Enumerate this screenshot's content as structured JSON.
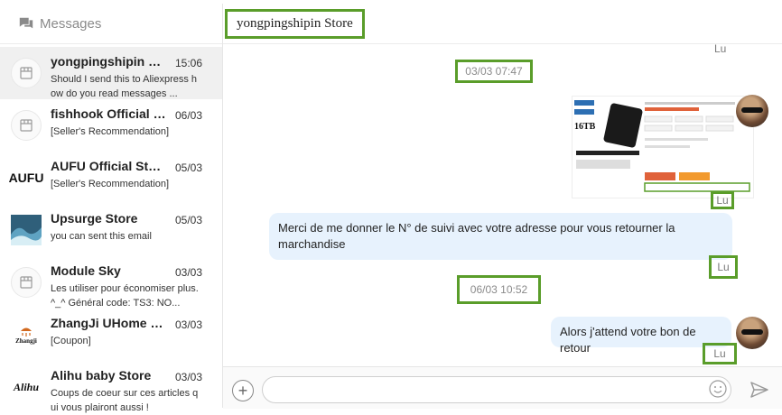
{
  "sidebar": {
    "title": "Messages",
    "conversations": [
      {
        "name": "yongpingshipin Store",
        "date": "15:06",
        "preview": "Should I send this to Aliexpress how do you read messages ...",
        "avatar": "store-icon",
        "active": true
      },
      {
        "name": "fishhook Official Store",
        "date": "06/03",
        "preview": "[Seller's Recommendation]",
        "avatar": "store-icon"
      },
      {
        "name": "AUFU Official Store",
        "date": "05/03",
        "preview": "[Seller's Recommendation]",
        "avatar": "AUFU"
      },
      {
        "name": "Upsurge Store",
        "date": "05/03",
        "preview": "you can sent this email",
        "avatar": "wave-image"
      },
      {
        "name": "Module Sky",
        "date": "03/03",
        "preview": "Les utiliser pour économiser plus. ^_^ Général code: TS3: NO...",
        "avatar": "store-icon"
      },
      {
        "name": "ZhangJi UHome sup...",
        "date": "03/03",
        "preview": "[Coupon]",
        "avatar": "Zhangji"
      },
      {
        "name": "Alihu baby Store",
        "date": "03/03",
        "preview": "Coups de coeur sur ces articles qui vous plairont aussi !",
        "avatar": "Alihu"
      }
    ]
  },
  "chat": {
    "title": "yongpingshipin Store",
    "read_label": "Lu",
    "messages": {
      "time1": "03/03 07:47",
      "product_text": "16TB",
      "bubble1": "Merci de me donner le N° de suivi avec votre adresse pour vous retourner la marchandise",
      "time2": "06/03 10:52",
      "bubble2": "Alors j'attend votre bon de retour"
    },
    "composer": {
      "add_label": "+",
      "placeholder": ""
    }
  },
  "colors": {
    "highlight": "#5a9d2a",
    "bubble": "#e7f2fd",
    "active_row": "#f0f0f0"
  }
}
